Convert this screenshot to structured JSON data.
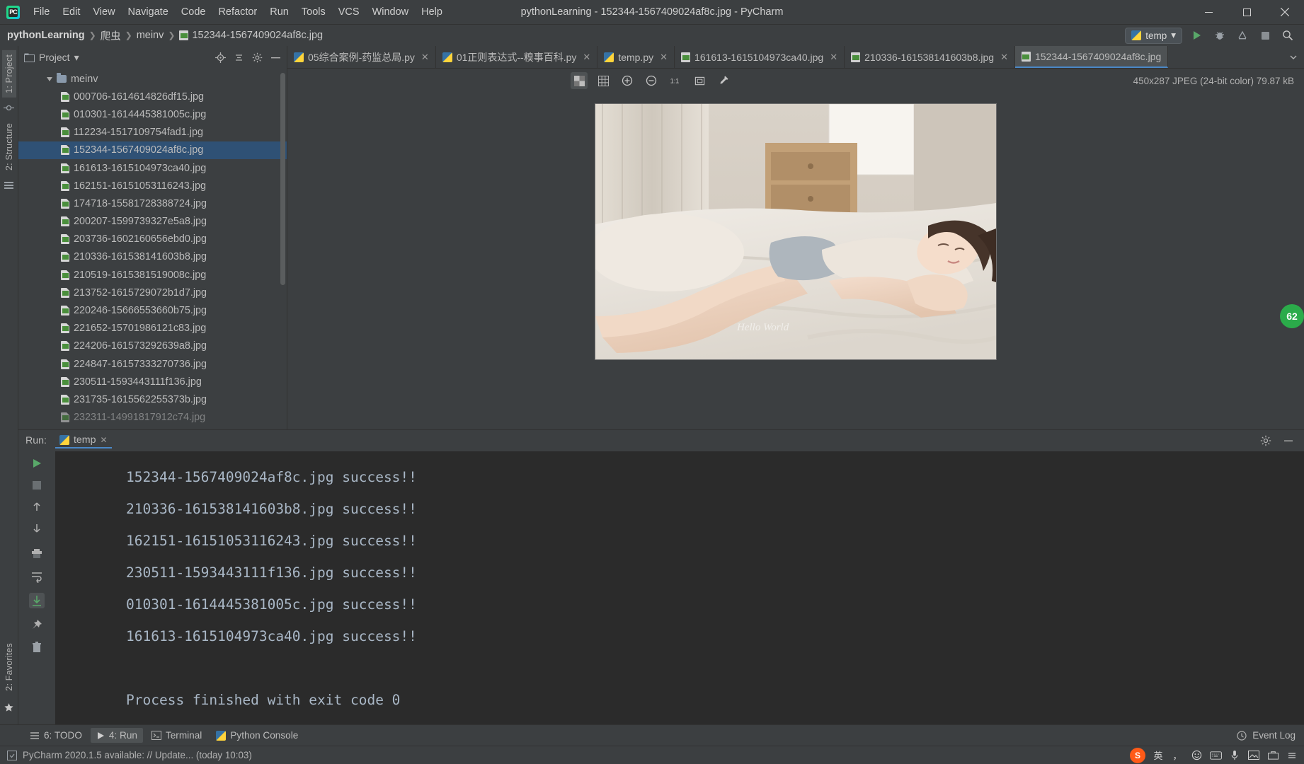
{
  "window": {
    "title": "pythonLearning - 152344-1567409024af8c.jpg - PyCharm",
    "logo_text": "PC",
    "minimize": "─",
    "maximize": "❐",
    "close": "✕"
  },
  "menubar": [
    {
      "label": "File"
    },
    {
      "label": "Edit"
    },
    {
      "label": "View"
    },
    {
      "label": "Navigate"
    },
    {
      "label": "Code"
    },
    {
      "label": "Refactor"
    },
    {
      "label": "Run"
    },
    {
      "label": "Tools"
    },
    {
      "label": "VCS"
    },
    {
      "label": "Window"
    },
    {
      "label": "Help"
    }
  ],
  "breadcrumb": {
    "project": "pythonLearning",
    "folder": "爬虫",
    "subfolder": "meinv",
    "file": "152344-1567409024af8c.jpg",
    "separator": "❯"
  },
  "toolbar_right": {
    "run_config": "temp",
    "dropdown_caret": "▾",
    "run": "run-button",
    "debug": "debug-button",
    "coverage": "coverage-button",
    "stop": "stop-button",
    "search": "search-button"
  },
  "left_strip": {
    "project_tab": "1: Project",
    "structure_tab": "2: Structure",
    "favorites_tab": "2: Favorites"
  },
  "project_panel": {
    "title": "Project",
    "caret": "▾",
    "actions": [
      "target-icon",
      "collapse-icon",
      "settings-icon",
      "hide-icon"
    ],
    "root": {
      "label": "meinv",
      "expanded": true
    },
    "files": [
      {
        "name": "000706-1614614826df15.jpg",
        "selected": false
      },
      {
        "name": "010301-1614445381005c.jpg",
        "selected": false
      },
      {
        "name": "112234-1517109754fad1.jpg",
        "selected": false
      },
      {
        "name": "152344-1567409024af8c.jpg",
        "selected": true
      },
      {
        "name": "161613-1615104973ca40.jpg",
        "selected": false
      },
      {
        "name": "162151-16151053116243.jpg",
        "selected": false
      },
      {
        "name": "174718-15581728388724.jpg",
        "selected": false
      },
      {
        "name": "200207-1599739327e5a8.jpg",
        "selected": false
      },
      {
        "name": "203736-1602160656ebd0.jpg",
        "selected": false
      },
      {
        "name": "210336-161538141603b8.jpg",
        "selected": false
      },
      {
        "name": "210519-1615381519008c.jpg",
        "selected": false
      },
      {
        "name": "213752-1615729072b1d7.jpg",
        "selected": false
      },
      {
        "name": "220246-15666553660b75.jpg",
        "selected": false
      },
      {
        "name": "221652-15701986121c83.jpg",
        "selected": false
      },
      {
        "name": "224206-161573292639a8.jpg",
        "selected": false
      },
      {
        "name": "224847-16157333270736.jpg",
        "selected": false
      },
      {
        "name": "230511-1593443111f136.jpg",
        "selected": false
      },
      {
        "name": "231735-1615562255373b.jpg",
        "selected": false
      },
      {
        "name": "232311-14991817912c74.jpg",
        "selected": false
      }
    ]
  },
  "editor_tabs": [
    {
      "label": "05综合案例-药监总局.py",
      "icon": "python-icon",
      "active": false,
      "close": "✕"
    },
    {
      "label": "01正则表达式--糗事百科.py",
      "icon": "python-icon",
      "active": false,
      "close": "✕"
    },
    {
      "label": "temp.py",
      "icon": "python-icon",
      "active": false,
      "close": "✕"
    },
    {
      "label": "161613-1615104973ca40.jpg",
      "icon": "image-icon",
      "active": false,
      "close": "✕"
    },
    {
      "label": "210336-161538141603b8.jpg",
      "icon": "image-icon",
      "active": false,
      "close": "✕"
    },
    {
      "label": "152344-1567409024af8c.jpg",
      "icon": "image-icon",
      "active": true,
      "close": ""
    }
  ],
  "image_viewer": {
    "toolbar": [
      "transparency-grid-icon",
      "grid-icon",
      "zoom-in-icon",
      "zoom-out-icon",
      "actual-size-icon",
      "fit-screen-icon",
      "color-picker-icon"
    ],
    "info": "450x287 JPEG (24-bit color) 79.87 kB"
  },
  "run_window": {
    "label": "Run:",
    "tab_label": "temp",
    "tab_close": "✕",
    "settings_icon": "gear-icon",
    "minimize_icon": "─",
    "side_buttons": [
      "rerun-icon",
      "stop-icon",
      "up-icon",
      "down-icon",
      "print-icon",
      "soft-wrap-icon",
      "scroll-end-icon",
      "pin-icon",
      "trash-icon"
    ],
    "console_lines": [
      "152344-1567409024af8c.jpg success!!",
      "210336-161538141603b8.jpg success!!",
      "162151-16151053116243.jpg success!!",
      "230511-1593443111f136.jpg success!!",
      "010301-1614445381005c.jpg success!!",
      "161613-1615104973ca40.jpg success!!",
      "",
      "Process finished with exit code 0"
    ]
  },
  "bottom_tabs": [
    {
      "label": "6: TODO",
      "icon": "todo-icon",
      "active": false
    },
    {
      "label": "4: Run",
      "icon": "run-icon",
      "active": true
    },
    {
      "label": "Terminal",
      "icon": "terminal-icon",
      "active": false
    },
    {
      "label": "Python Console",
      "icon": "python-icon",
      "active": false
    }
  ],
  "bottom_right": {
    "event_log": "Event Log"
  },
  "statusbar": {
    "message": "PyCharm 2020.1.5 available: // Update... (today 10:03)"
  },
  "tray": {
    "sogou": "S",
    "lang": "英",
    "items": [
      "comma-icon",
      "smiley-icon",
      "keyboard-icon",
      "mic-icon",
      "image-tool-icon",
      "toolbox-icon",
      "menu-icon"
    ]
  },
  "right_badge": {
    "value": "62"
  },
  "colors": {
    "accent": "#4a88c7",
    "selection": "#2f5175",
    "console_bg": "#2b2b2b",
    "console_text": "#a9b7c6",
    "panel_bg": "#3c3f41",
    "green": "#59a869"
  }
}
